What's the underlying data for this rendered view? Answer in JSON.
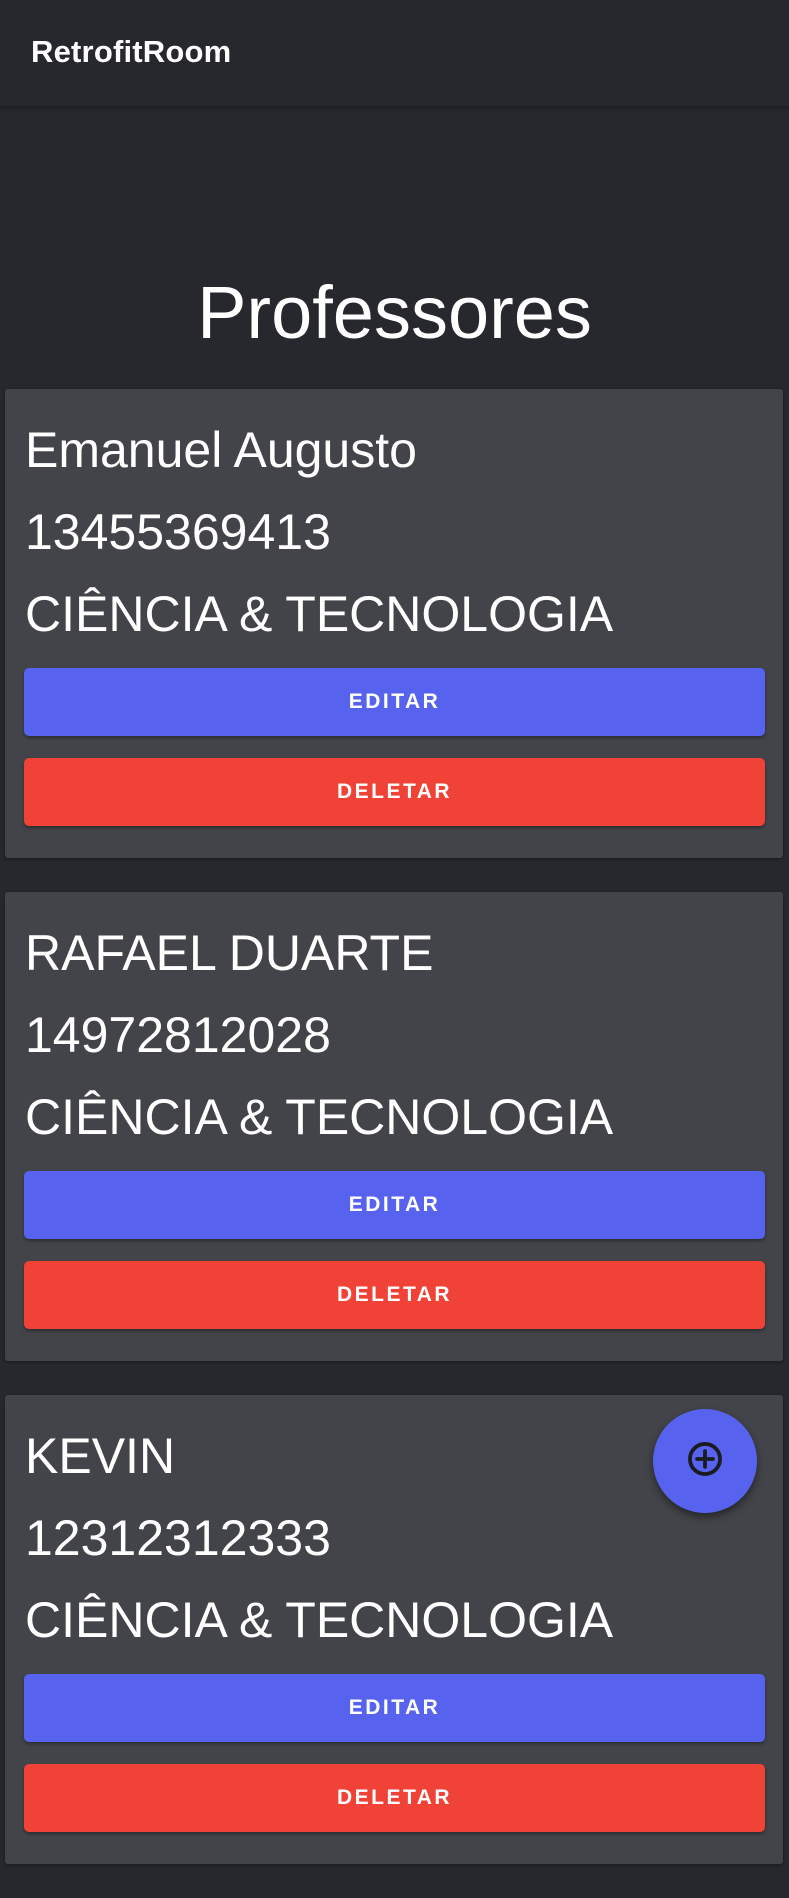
{
  "app_bar": {
    "title": "RetrofitRoom"
  },
  "page": {
    "heading": "Professores"
  },
  "professors": [
    {
      "name": "Emanuel Augusto",
      "id": "13455369413",
      "department": "CIÊNCIA & TECNOLOGIA",
      "edit_label": "EDITAR",
      "delete_label": "DELETAR"
    },
    {
      "name": "RAFAEL DUARTE",
      "id": "14972812028",
      "department": "CIÊNCIA & TECNOLOGIA",
      "edit_label": "EDITAR",
      "delete_label": "DELETAR"
    },
    {
      "name": "KEVIN",
      "id": "12312312333",
      "department": "CIÊNCIA & TECNOLOGIA",
      "edit_label": "EDITAR",
      "delete_label": "DELETAR"
    }
  ],
  "fab": {
    "icon": "add-circle-outline-icon"
  },
  "colors": {
    "background": "#26282d",
    "card": "#424449",
    "primary": "#5763ef",
    "danger": "#f04236"
  }
}
